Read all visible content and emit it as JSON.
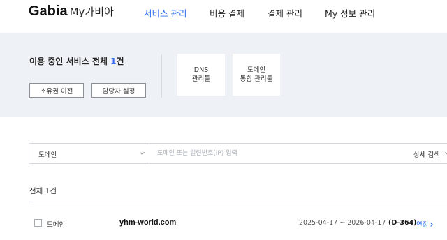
{
  "header": {
    "logo_brand": "Gabia",
    "logo_sub": "My가비아",
    "nav": [
      {
        "label": "서비스 관리",
        "active": true
      },
      {
        "label": "비용 결제",
        "active": false
      },
      {
        "label": "결제 관리",
        "active": false
      },
      {
        "label": "My 정보 관리",
        "active": false
      }
    ]
  },
  "summary": {
    "title_prefix": "이용 중인 서비스 전체 ",
    "count": "1",
    "title_suffix": "건",
    "buttons": [
      "소유권 이전",
      "담당자 설정"
    ],
    "service_cards": [
      {
        "line1": "DNS",
        "line2": "관리툴"
      },
      {
        "line1": "도메인",
        "line2": "통합 관리툴"
      }
    ]
  },
  "search": {
    "category": "도메인",
    "placeholder": "도메인 또는 일련번호(IP) 입력",
    "advanced_label": "상세 검색"
  },
  "list": {
    "total": "전체 1건",
    "rows": [
      {
        "type": "도메인",
        "domain": "yhm-world.com",
        "period": "2025-04-17 ~ 2026-04-17",
        "dday": "(D-364)",
        "action": "연장"
      }
    ]
  },
  "colors": {
    "accent": "#2f6ef0",
    "summary_bg": "#eef1f5",
    "border": "#d3d6dc"
  }
}
